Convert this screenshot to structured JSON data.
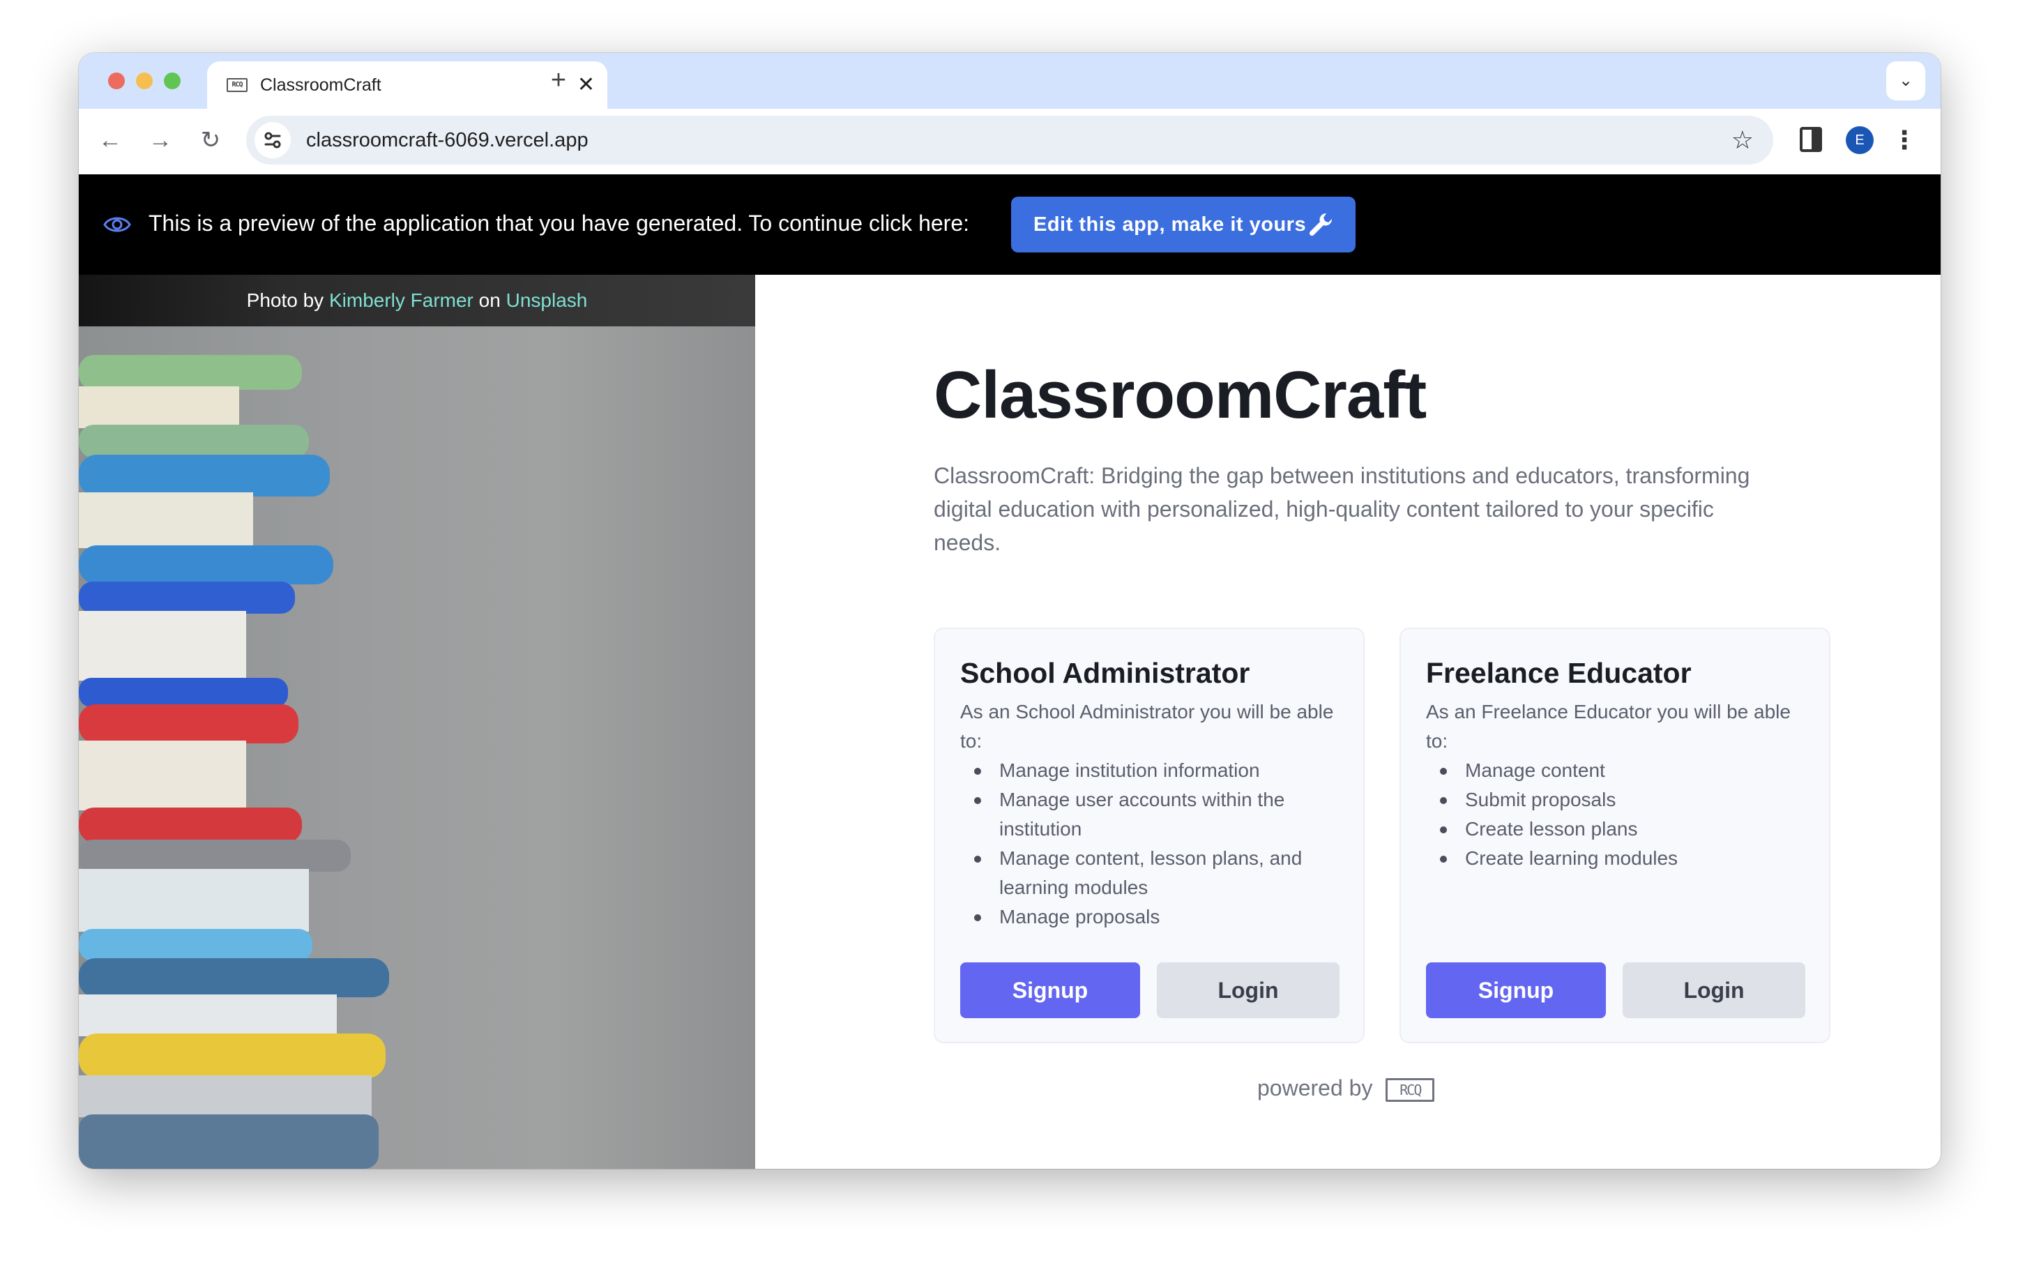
{
  "browser": {
    "tab_title": "ClassroomCraft",
    "favicon_text": "RCQ",
    "close_glyph": "✕",
    "new_tab_glyph": "+",
    "tabstrip_menu_glyph": "⌄",
    "url": "classroomcraft-6069.vercel.app",
    "back_glyph": "←",
    "forward_glyph": "→",
    "reload_glyph": "↻",
    "star_glyph": "☆",
    "profile_initial": "E",
    "menu_glyph": "⋮"
  },
  "banner": {
    "text": "This is a preview of the application that you have generated. To continue click here:",
    "button_label": "Edit this app, make it yours",
    "icon": "eye-icon",
    "button_icon": "wrench-icon"
  },
  "photo_credit": {
    "prefix": "Photo by",
    "author": "Kimberly Farmer",
    "middle": "on",
    "source": "Unsplash"
  },
  "main": {
    "title": "ClassroomCraft",
    "subtitle": "ClassroomCraft: Bridging the gap between institutions and educators, transforming digital education with personalized, high-quality content tailored to your specific needs.",
    "cards": [
      {
        "title": "School Administrator",
        "description": "As an School Administrator you will be able to:",
        "items": [
          "Manage institution information",
          "Manage user accounts within the institution",
          "Manage content, lesson plans, and learning modules",
          "Manage proposals"
        ],
        "signup_label": "Signup",
        "login_label": "Login"
      },
      {
        "title": "Freelance Educator",
        "description": "As an Freelance Educator you will be able to:",
        "items": [
          "Manage content",
          "Submit proposals",
          "Create lesson plans",
          "Create learning modules"
        ],
        "signup_label": "Signup",
        "login_label": "Login"
      }
    ],
    "powered_by": "powered by",
    "powered_logo": "RCQ"
  },
  "colors": {
    "accent": "#6366f1",
    "banner_button": "#3b6fe0",
    "credit_link": "#7fe0d2",
    "tabstrip": "#d3e3fd"
  }
}
